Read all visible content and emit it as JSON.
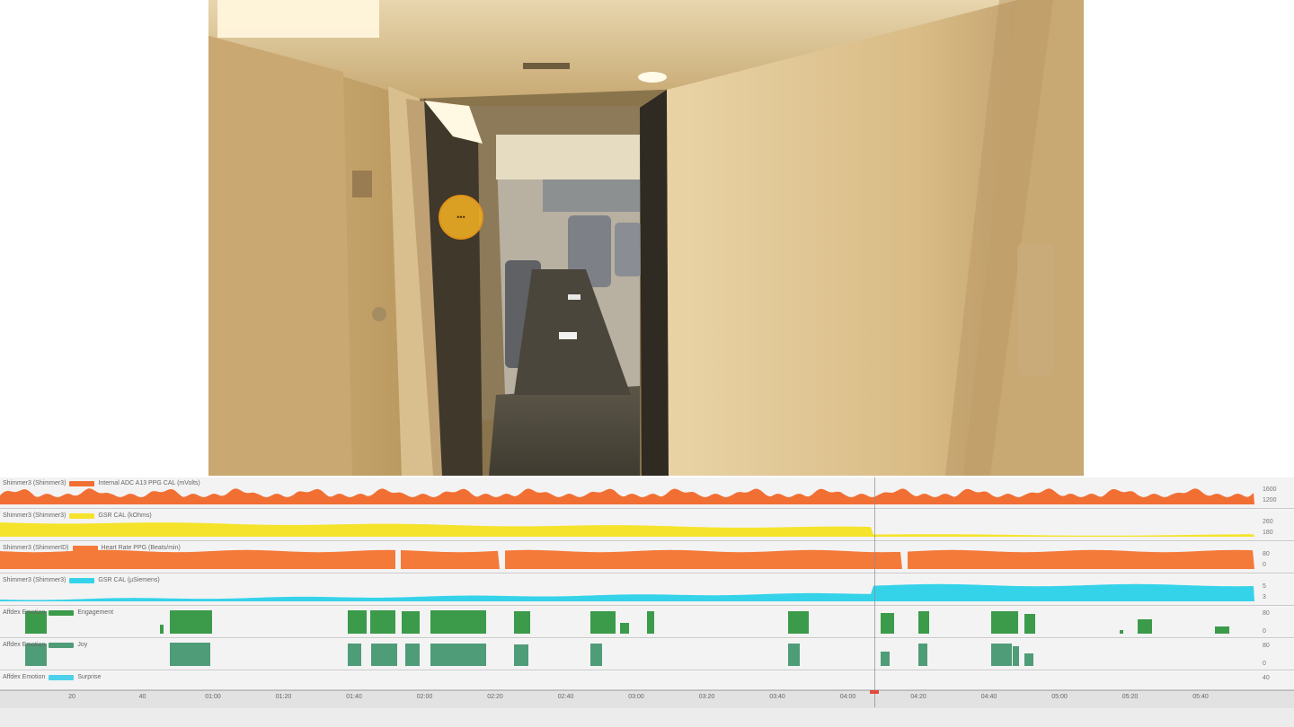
{
  "video": {
    "gaze_marker_label": "•••",
    "scene": "train-vestibule"
  },
  "colors": {
    "ppg": "#f26f33",
    "gsr_kohms": "#f5e32b",
    "heart_rate": "#f47a3a",
    "gsr_usiemens": "#35d3ea",
    "engagement": "#3b9b4a",
    "joy": "#4f9c78",
    "surprise": "#4fd0ea",
    "gaze": "#f4b323"
  },
  "tracks": [
    {
      "label": "Shimmer3 (Shimmer3)",
      "series": "Internal ADC A13 PPG CAL (mVolts)",
      "scale_top": "1600",
      "scale_bottom": "1200"
    },
    {
      "label": "Shimmer3 (Shimmer3)",
      "series": "GSR CAL (kOhms)",
      "scale_top": "260",
      "scale_bottom": "180"
    },
    {
      "label": "Shimmer3 (ShimmerID)",
      "series": "Heart Rate PPG (Beats/min)",
      "scale_top": "80",
      "scale_bottom": "0"
    },
    {
      "label": "Shimmer3 (Shimmer3)",
      "series": "GSR CAL (µSiemens)",
      "scale_top": "5",
      "scale_bottom": "3"
    },
    {
      "label": "Affdex Emotion",
      "series": "Engagement",
      "scale_top": "80",
      "scale_bottom": "0"
    },
    {
      "label": "Affdex Emotion",
      "series": "Joy",
      "scale_top": "80",
      "scale_bottom": "0"
    },
    {
      "label": "Affdex Emotion",
      "series": "Surprise",
      "scale_top": "40",
      "scale_bottom": ""
    }
  ],
  "ruler_ticks": [
    "20",
    "40",
    "01:00",
    "01:20",
    "01:40",
    "02:00",
    "02:20",
    "02:40",
    "03:00",
    "03:20",
    "03:40",
    "04:00",
    "04:20",
    "04:40",
    "05:00",
    "05:20",
    "05:40"
  ]
}
